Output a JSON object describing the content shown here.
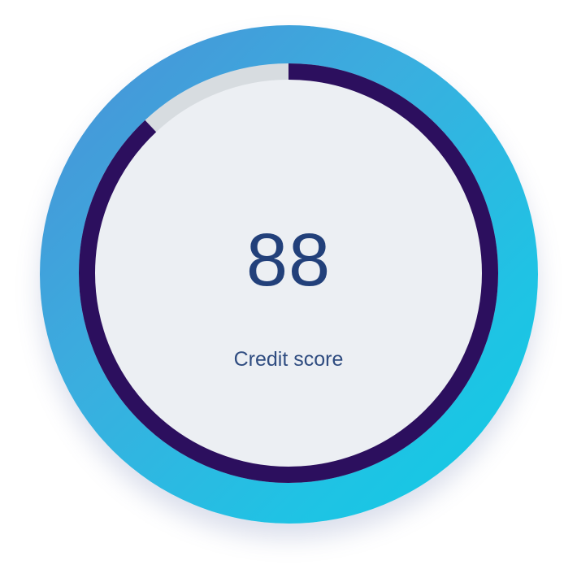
{
  "gauge": {
    "value": "88",
    "label": "Credit score",
    "progress_fraction": 0.88,
    "colors": {
      "ring_gradient_start": "#4a8fd6",
      "ring_gradient_end": "#0fcbe3",
      "progress": "#2c0f5e",
      "track": "#d7dce0",
      "face": "#eceff3",
      "text": "#22407a"
    }
  }
}
